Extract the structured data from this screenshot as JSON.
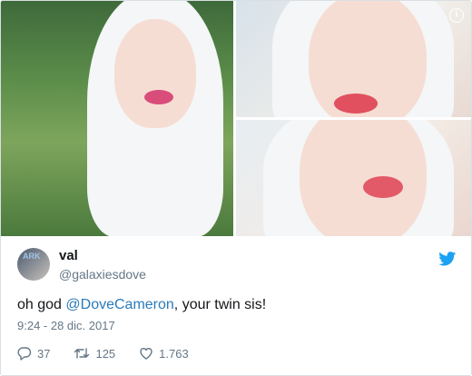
{
  "media": {
    "info_icon": "i"
  },
  "user": {
    "name": "val",
    "handle": "@galaxiesdove",
    "avatar_label": "ARK"
  },
  "tweet": {
    "text_before": "oh god ",
    "mention": "@DoveCameron",
    "text_after": ", your twin sis!",
    "timestamp": "9:24 - 28 dic. 2017"
  },
  "actions": {
    "replies": "37",
    "retweets": "125",
    "likes": "1.763"
  },
  "colors": {
    "twitter_blue": "#1da1f2",
    "mention": "#2b7bb9",
    "muted": "#657786"
  }
}
